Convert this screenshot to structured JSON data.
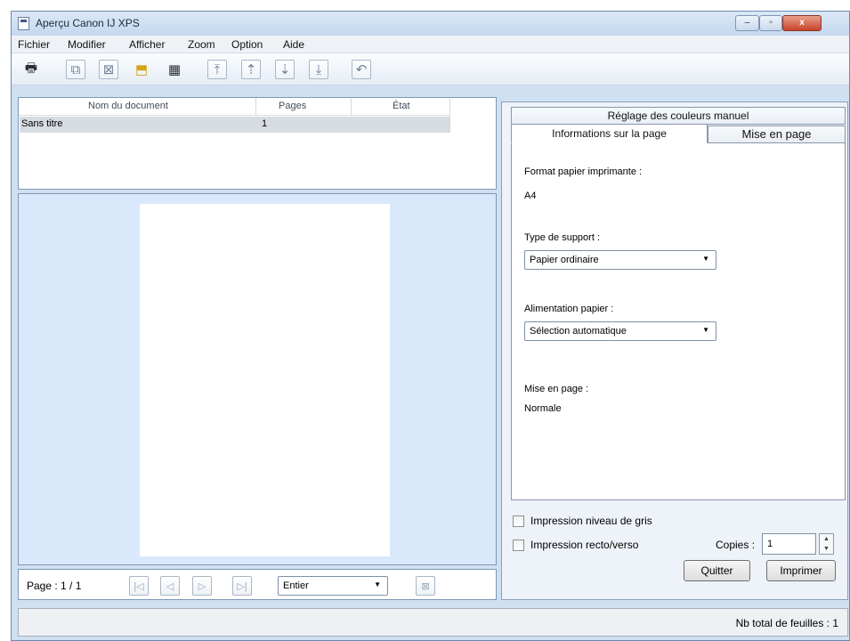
{
  "window": {
    "title": "Aperçu Canon IJ XPS",
    "controls": {
      "minimize": "–",
      "maximize": "▫",
      "close": "x"
    }
  },
  "menu": {
    "items": [
      {
        "label": "Fichier"
      },
      {
        "label": "Modifier"
      },
      {
        "label": "Afficher"
      },
      {
        "label": "Zoom"
      },
      {
        "label": "Option"
      },
      {
        "label": "Aide"
      }
    ]
  },
  "toolbar": {
    "buttons": [
      {
        "name": "print-icon",
        "glyph": "🖶"
      },
      {
        "name": "combine-doc-icon",
        "glyph": "⧉"
      },
      {
        "name": "delete-doc-icon",
        "glyph": "⊠"
      },
      {
        "name": "doc-settings-icon",
        "glyph": "⬒"
      },
      {
        "name": "thumbnail-view-icon",
        "glyph": "▦"
      },
      {
        "name": "move-first-icon",
        "glyph": "⤒"
      },
      {
        "name": "move-up-icon",
        "glyph": "⇡"
      },
      {
        "name": "move-down-icon",
        "glyph": "⇣"
      },
      {
        "name": "move-last-icon",
        "glyph": "⤓"
      },
      {
        "name": "undo-icon",
        "glyph": "↶"
      }
    ]
  },
  "document_list": {
    "columns": [
      "Nom du document",
      "Pages",
      "État"
    ],
    "rows": [
      {
        "name": "Sans titre",
        "pages": "1",
        "state": ""
      }
    ]
  },
  "navigation": {
    "page_label": "Page : 1 / 1",
    "buttons": [
      {
        "name": "first-page-icon",
        "glyph": "|◁"
      },
      {
        "name": "prev-page-icon",
        "glyph": "◁"
      },
      {
        "name": "next-page-icon",
        "glyph": "▷"
      },
      {
        "name": "last-page-icon",
        "glyph": "▷|"
      }
    ],
    "zoom_value": "Entier",
    "close_icon_name": "delete-page-icon"
  },
  "right_panel": {
    "tabs": {
      "color": "Réglage des couleurs manuel",
      "info": "Informations sur la page",
      "layout": "Mise en page"
    },
    "format_label": "Format papier imprimante :",
    "format_value": "A4",
    "media_label": "Type de support :",
    "media_value": "Papier ordinaire",
    "source_label": "Alimentation papier :",
    "source_value": "Sélection automatique",
    "layout_label": "Mise en page :",
    "layout_value": "Normale",
    "grayscale_label": "Impression niveau de gris",
    "duplex_label": "Impression recto/verso",
    "copies_label": "Copies :",
    "copies_value": "1",
    "quit_label": "Quitter",
    "print_label": "Imprimer"
  },
  "status": {
    "text": "Nb total de feuilles : 1"
  },
  "colors": {
    "window_bg": "#cfe0f2",
    "preview_bg": "#d9e9fb",
    "selected_row": "#d7dbe2",
    "close_button": "#c6432b"
  }
}
